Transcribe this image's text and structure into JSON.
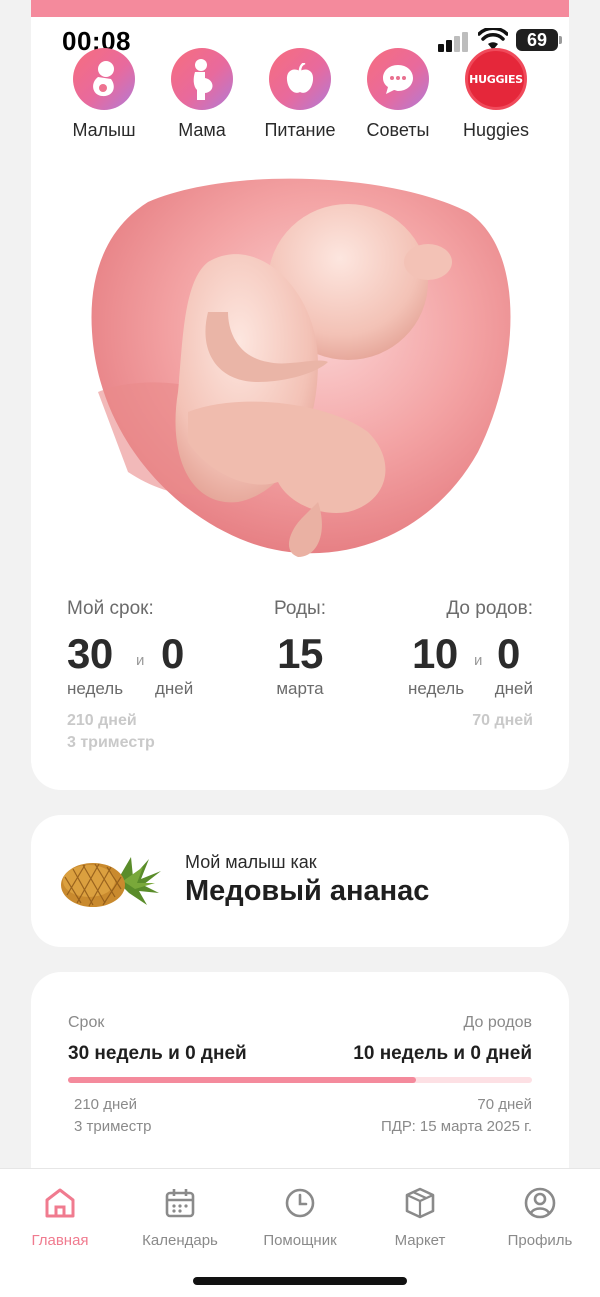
{
  "status": {
    "time": "00:08",
    "battery": "69"
  },
  "categories": [
    {
      "label": "Малыш",
      "icon": "baby-icon"
    },
    {
      "label": "Мама",
      "icon": "pregnant-mother-icon"
    },
    {
      "label": "Питание",
      "icon": "apple-icon"
    },
    {
      "label": "Советы",
      "icon": "chat-bubble-icon"
    },
    {
      "label": "Huggies",
      "icon": "huggies-logo",
      "logo_text": "HUGGIES"
    }
  ],
  "term": {
    "label": "Мой срок:",
    "weeks": "30",
    "and": "и",
    "days": "0",
    "weeks_unit": "недель",
    "days_unit": "дней",
    "total_days": "210 дней",
    "trimester": "3 триместр"
  },
  "birth": {
    "label": "Роды:",
    "day": "15",
    "month": "марта"
  },
  "until": {
    "label": "До родов:",
    "weeks": "10",
    "and": "и",
    "days": "0",
    "weeks_unit": "недель",
    "days_unit": "дней",
    "total_days": "70 дней"
  },
  "fruit": {
    "caption": "Мой малыш как",
    "name": "Медовый ананас"
  },
  "progress": {
    "left_label": "Срок",
    "right_label": "До родов",
    "left_value": "30 недель и 0 дней",
    "right_value": "10 недель и 0 дней",
    "fraction": 0.75,
    "left_days": "210 дней",
    "left_trimester": "3 триместр",
    "right_days": "70 дней",
    "due_date": "ПДР: 15 марта 2025 г."
  },
  "tabs": [
    {
      "label": "Главная",
      "icon": "home-icon",
      "active": true
    },
    {
      "label": "Календарь",
      "icon": "calendar-icon",
      "active": false
    },
    {
      "label": "Помощник",
      "icon": "clock-icon",
      "active": false
    },
    {
      "label": "Маркет",
      "icon": "box-icon",
      "active": false
    },
    {
      "label": "Профиль",
      "icon": "profile-icon",
      "active": false
    }
  ],
  "colors": {
    "accent": "#f48a9c",
    "active_tab": "#f07b8f",
    "huggies": "#e5273a"
  }
}
